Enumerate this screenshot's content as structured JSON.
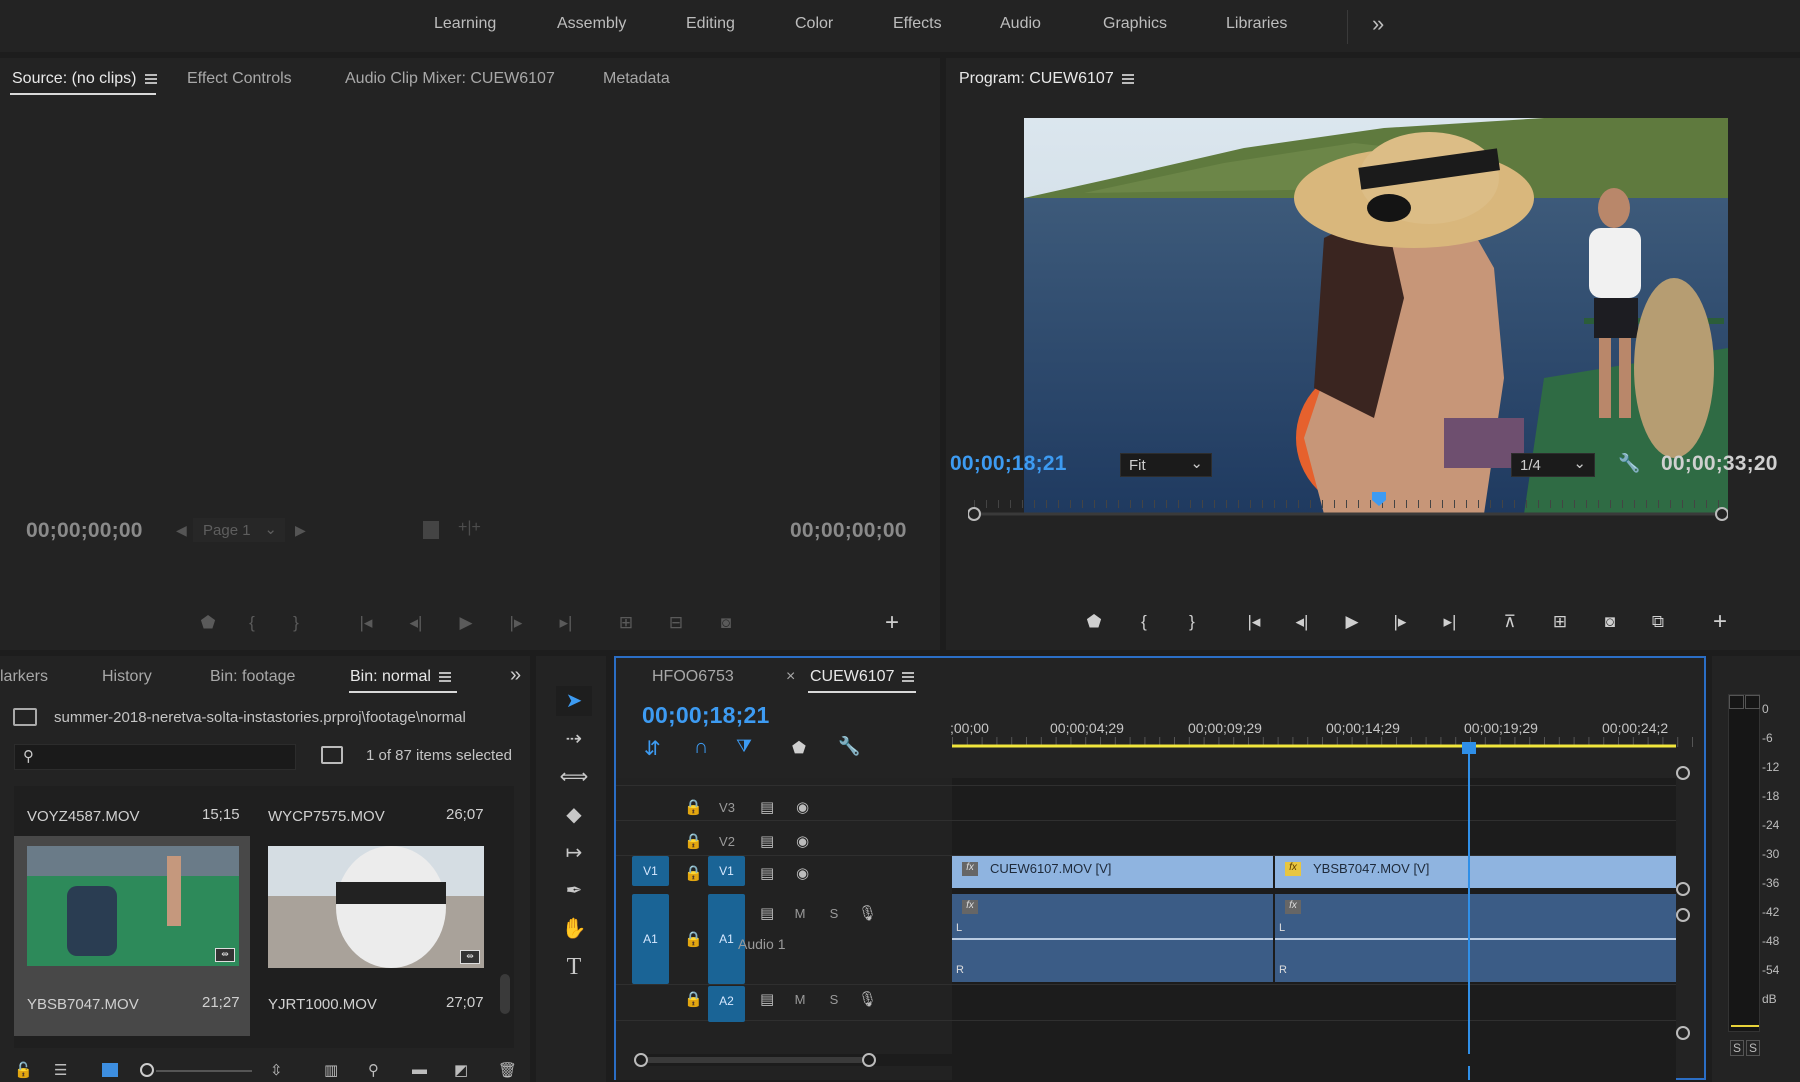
{
  "workspaces": [
    "Learning",
    "Assembly",
    "Editing",
    "Color",
    "Effects",
    "Audio",
    "Graphics",
    "Libraries"
  ],
  "workspace_overflow": "»",
  "source_panel": {
    "tabs": [
      "Source: (no clips)",
      "Effect Controls",
      "Audio Clip Mixer: CUEW6107",
      "Metadata"
    ],
    "tc_left": "00;00;00;00",
    "tc_right": "00;00;00;00",
    "page": "Page 1"
  },
  "program_panel": {
    "title": "Program: CUEW6107",
    "tc_current": "00;00;18;21",
    "zoom": "Fit",
    "resolution": "1/4",
    "tc_duration": "00;00;33;20"
  },
  "project_panel": {
    "tabs": [
      "larkers",
      "History",
      "Bin: footage",
      "Bin: normal"
    ],
    "path": "summer-2018-neretva-solta-instastories.prproj\\footage\\normal",
    "search_placeholder": "",
    "selection_count": "1 of 87 items selected",
    "items": [
      {
        "name": "VOYZ4587.MOV",
        "duration": "15;15"
      },
      {
        "name": "WYCP7575.MOV",
        "duration": "26;07"
      },
      {
        "name": "YBSB7047.MOV",
        "duration": "21;27"
      },
      {
        "name": "YJRT1000.MOV",
        "duration": "27;07"
      }
    ]
  },
  "timeline": {
    "tabs": [
      "HFOO6753",
      "CUEW6107"
    ],
    "close_glyph": "×",
    "tc_current": "00;00;18;21",
    "ruler": [
      ";00;00",
      "00;00;04;29",
      "00;00;09;29",
      "00;00;14;29",
      "00;00;19;29",
      "00;00;24;2"
    ],
    "tracks": {
      "v3": "V3",
      "v2": "V2",
      "v1": "V1",
      "v1_src": "V1",
      "a1": "A1",
      "a1_src": "A1",
      "a2": "A2",
      "mute": "M",
      "solo": "S",
      "audio1_name": "Audio 1"
    },
    "clips": {
      "v_clip_1": "CUEW6107.MOV [V]",
      "v_clip_2": "YBSB7047.MOV [V]",
      "fx": "fx",
      "ch_l": "L",
      "ch_r": "R"
    }
  },
  "audio_meter": {
    "scale": [
      "0",
      "-6",
      "-12",
      "-18",
      "-24",
      "-30",
      "-36",
      "-42",
      "-48",
      "-54",
      "dB"
    ],
    "solo_left": "S",
    "solo_right": "S"
  },
  "colors": {
    "accent_blue": "#3d9bf2",
    "video_clip": "#8fb4e0",
    "audio_clip": "#3b5c86",
    "track_target": "#1a6496",
    "playhead": "#2f8fe8",
    "work_area": "#f0e63c"
  }
}
